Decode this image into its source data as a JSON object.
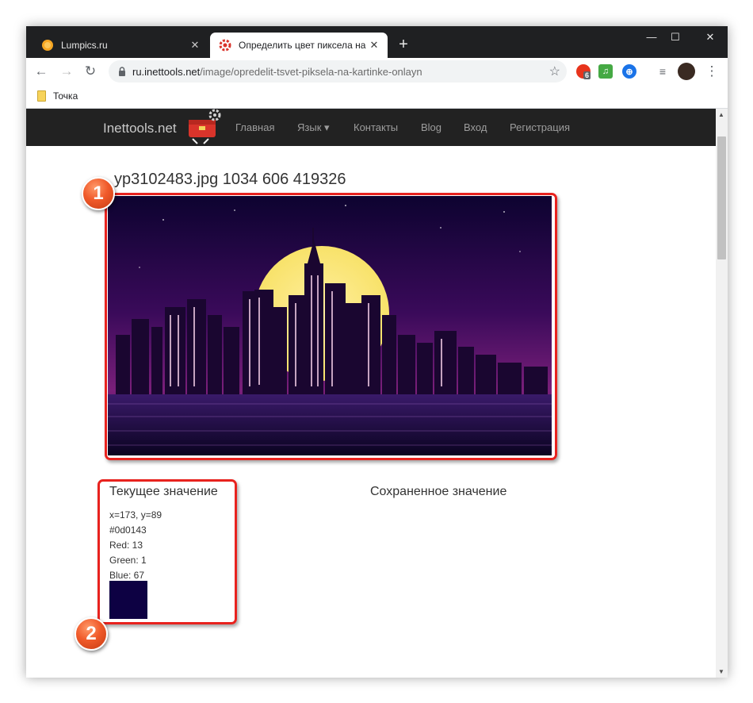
{
  "browser": {
    "tabs": [
      {
        "title": "Lumpics.ru",
        "active": false,
        "favicon": "lumpics-favicon"
      },
      {
        "title": "Определить цвет пиксела на ка",
        "active": true,
        "favicon": "inettools-gear-favicon"
      }
    ],
    "new_tab": "+",
    "window_controls": {
      "minimize": "—",
      "maximize": "☐",
      "close": "✕"
    },
    "url_host": "ru.inettools.net",
    "url_path": "/image/opredelit-tsvet-piksela-na-kartinke-onlayn",
    "extension_badge": "6",
    "bookmark": "Точка"
  },
  "site": {
    "brand": "Inettools.net",
    "nav": [
      "Главная",
      "Язык ▾",
      "Контакты",
      "Blog",
      "Вход",
      "Регистрация"
    ]
  },
  "page": {
    "heading": "yp3102483.jpg 1034 606 419326",
    "current_title": "Текущее значение",
    "saved_title": "Сохраненное значение",
    "coords": "x=173, y=89",
    "hex": "#0d0143",
    "red": "Red: 13",
    "green": "Green: 1",
    "blue": "Blue: 67",
    "swatch_color": "#0d0143"
  },
  "callouts": {
    "one": "1",
    "two": "2"
  },
  "colors": {
    "highlight": "#e8221e",
    "titlebar": "#1f2022",
    "sitenav": "#222222"
  }
}
